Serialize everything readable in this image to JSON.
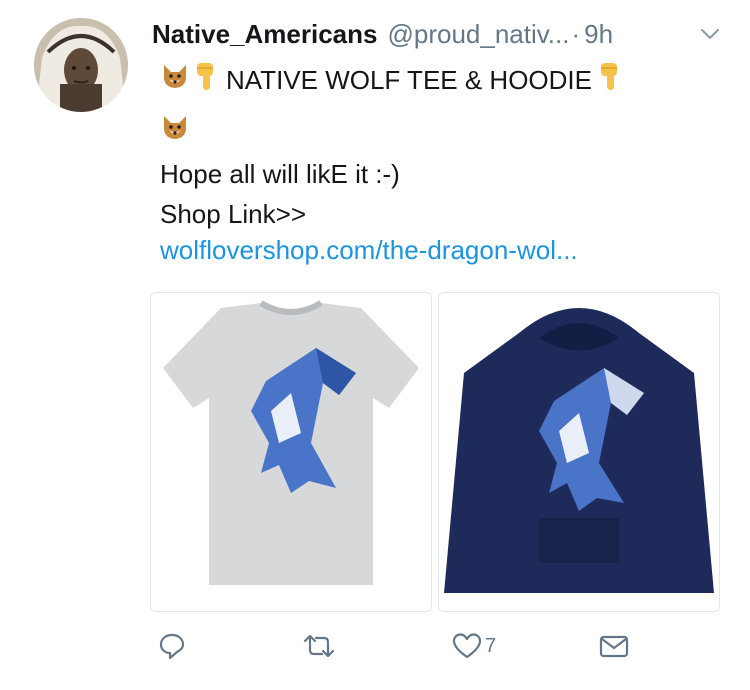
{
  "tweet": {
    "display_name": "Native_Americans",
    "handle": "@proud_nativ...",
    "dot": "·",
    "time": "9h",
    "title_text": "NATIVE WOLF TEE & HOODIE",
    "line2": "Hope all will likE it :-)",
    "line3": "Shop Link>>",
    "link": "wolfl​overshop.com/the-dragon-wol..."
  },
  "actions": {
    "like_count": "7"
  },
  "colors": {
    "link": "#1b95e0",
    "secondary": "#657786",
    "hoodie": "#1e2a5a",
    "tee": "#d6d8da"
  },
  "icons": [
    "wolf-emoji-icon",
    "pointing-down-emoji-icon",
    "chevron-down-icon",
    "reply-icon",
    "retweet-icon",
    "heart-icon",
    "envelope-icon"
  ]
}
